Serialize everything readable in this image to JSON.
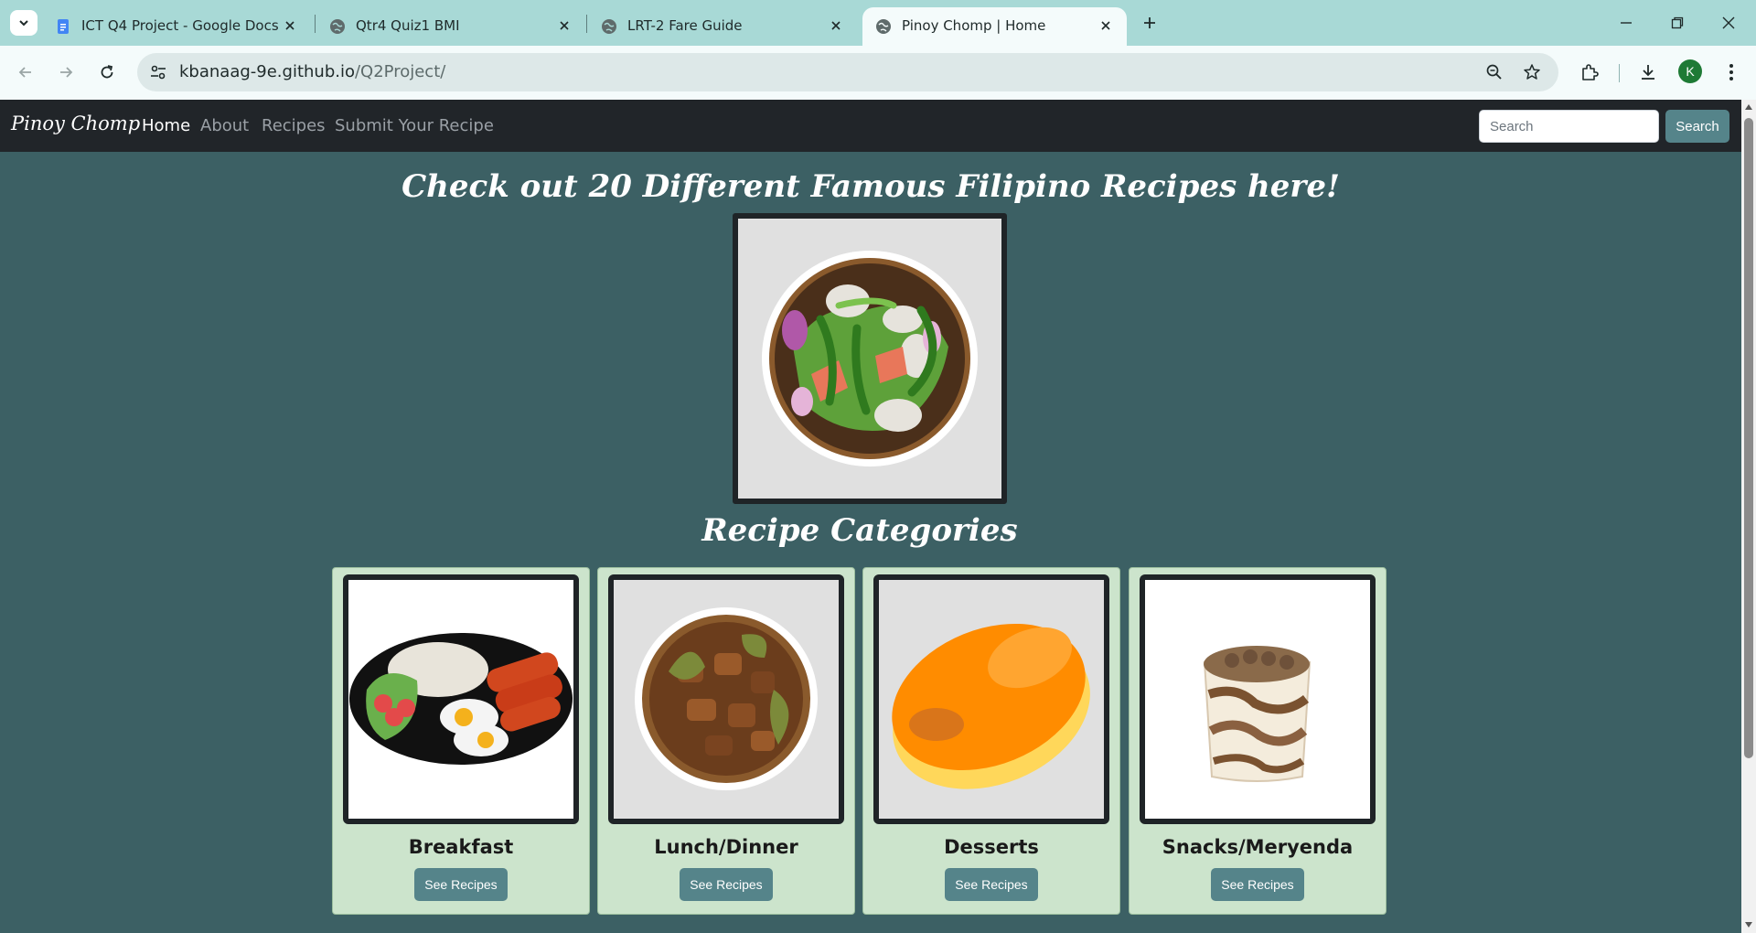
{
  "browser": {
    "tabs": [
      {
        "title": "ICT Q4 Project - Google Docs",
        "icon": "google-docs-icon",
        "active": false
      },
      {
        "title": "Qtr4 Quiz1 BMI",
        "icon": "globe-icon",
        "active": false
      },
      {
        "title": "LRT-2 Fare Guide",
        "icon": "globe-icon",
        "active": false
      },
      {
        "title": "Pinoy Chomp | Home",
        "icon": "globe-icon",
        "active": true
      }
    ],
    "url_host": "kbanaag-9e.github.io",
    "url_path": "/Q2Project/",
    "profile_initial": "K"
  },
  "navbar": {
    "brand": "Pinoy Chomp",
    "links": [
      "Home",
      "About",
      "Recipes",
      "Submit Your Recipe"
    ],
    "active_link": "Home",
    "search_placeholder": "Search",
    "search_button": "Search"
  },
  "main": {
    "headline": "Check out 20 Different Famous Filipino Recipes here!",
    "hero_image": "pinakbet-bowl",
    "categories_title": "Recipe Categories",
    "categories": [
      {
        "name": "Breakfast",
        "button": "See Recipes",
        "image": "silog-plate"
      },
      {
        "name": "Lunch/Dinner",
        "button": "See Recipes",
        "image": "adobo-bowl"
      },
      {
        "name": "Desserts",
        "button": "See Recipes",
        "image": "leche-flan"
      },
      {
        "name": "Snacks/Meryenda",
        "button": "See Recipes",
        "image": "taho-cup"
      }
    ]
  },
  "colors": {
    "page_bg": "#3c6064",
    "navbar_bg": "#212529",
    "card_bg": "#cce4cc",
    "button_bg": "#55848a",
    "tabbar_bg": "#a8d9d6"
  }
}
